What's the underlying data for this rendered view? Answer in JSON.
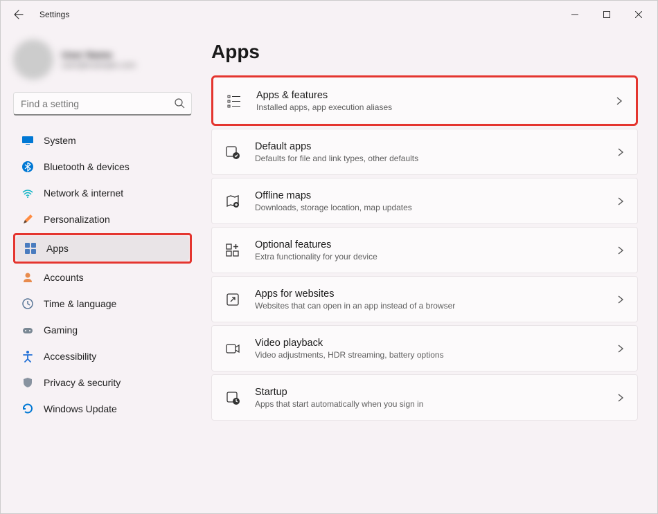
{
  "window": {
    "title": "Settings"
  },
  "profile": {
    "name": "User Name",
    "email": "user@example.com"
  },
  "search": {
    "placeholder": "Find a setting"
  },
  "sidebar": {
    "items": [
      {
        "label": "System"
      },
      {
        "label": "Bluetooth & devices"
      },
      {
        "label": "Network & internet"
      },
      {
        "label": "Personalization"
      },
      {
        "label": "Apps"
      },
      {
        "label": "Accounts"
      },
      {
        "label": "Time & language"
      },
      {
        "label": "Gaming"
      },
      {
        "label": "Accessibility"
      },
      {
        "label": "Privacy & security"
      },
      {
        "label": "Windows Update"
      }
    ]
  },
  "page": {
    "title": "Apps"
  },
  "cards": [
    {
      "title": "Apps & features",
      "desc": "Installed apps, app execution aliases"
    },
    {
      "title": "Default apps",
      "desc": "Defaults for file and link types, other defaults"
    },
    {
      "title": "Offline maps",
      "desc": "Downloads, storage location, map updates"
    },
    {
      "title": "Optional features",
      "desc": "Extra functionality for your device"
    },
    {
      "title": "Apps for websites",
      "desc": "Websites that can open in an app instead of a browser"
    },
    {
      "title": "Video playback",
      "desc": "Video adjustments, HDR streaming, battery options"
    },
    {
      "title": "Startup",
      "desc": "Apps that start automatically when you sign in"
    }
  ]
}
